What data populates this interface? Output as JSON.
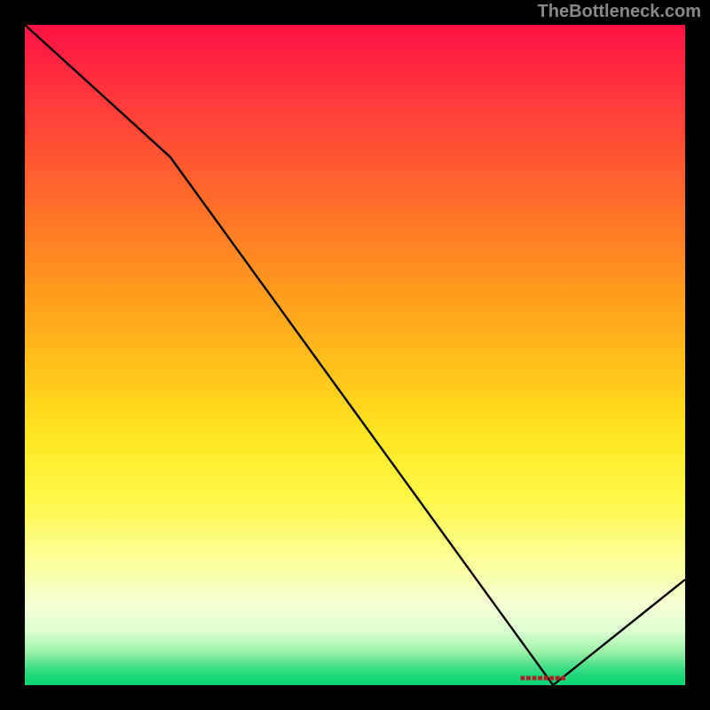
{
  "attribution": "TheBottleneck.com",
  "chart_data": {
    "type": "line",
    "title": "",
    "xlabel": "",
    "ylabel": "",
    "x": [
      0,
      0.22,
      0.8,
      1.0
    ],
    "values": [
      1.0,
      0.8,
      0.0,
      0.16
    ],
    "ylim": [
      0,
      1
    ],
    "xlim": [
      0,
      1
    ],
    "annotations": [
      {
        "x": 0.785,
        "y": 0.0,
        "text": "■■■■■■■■"
      }
    ]
  }
}
